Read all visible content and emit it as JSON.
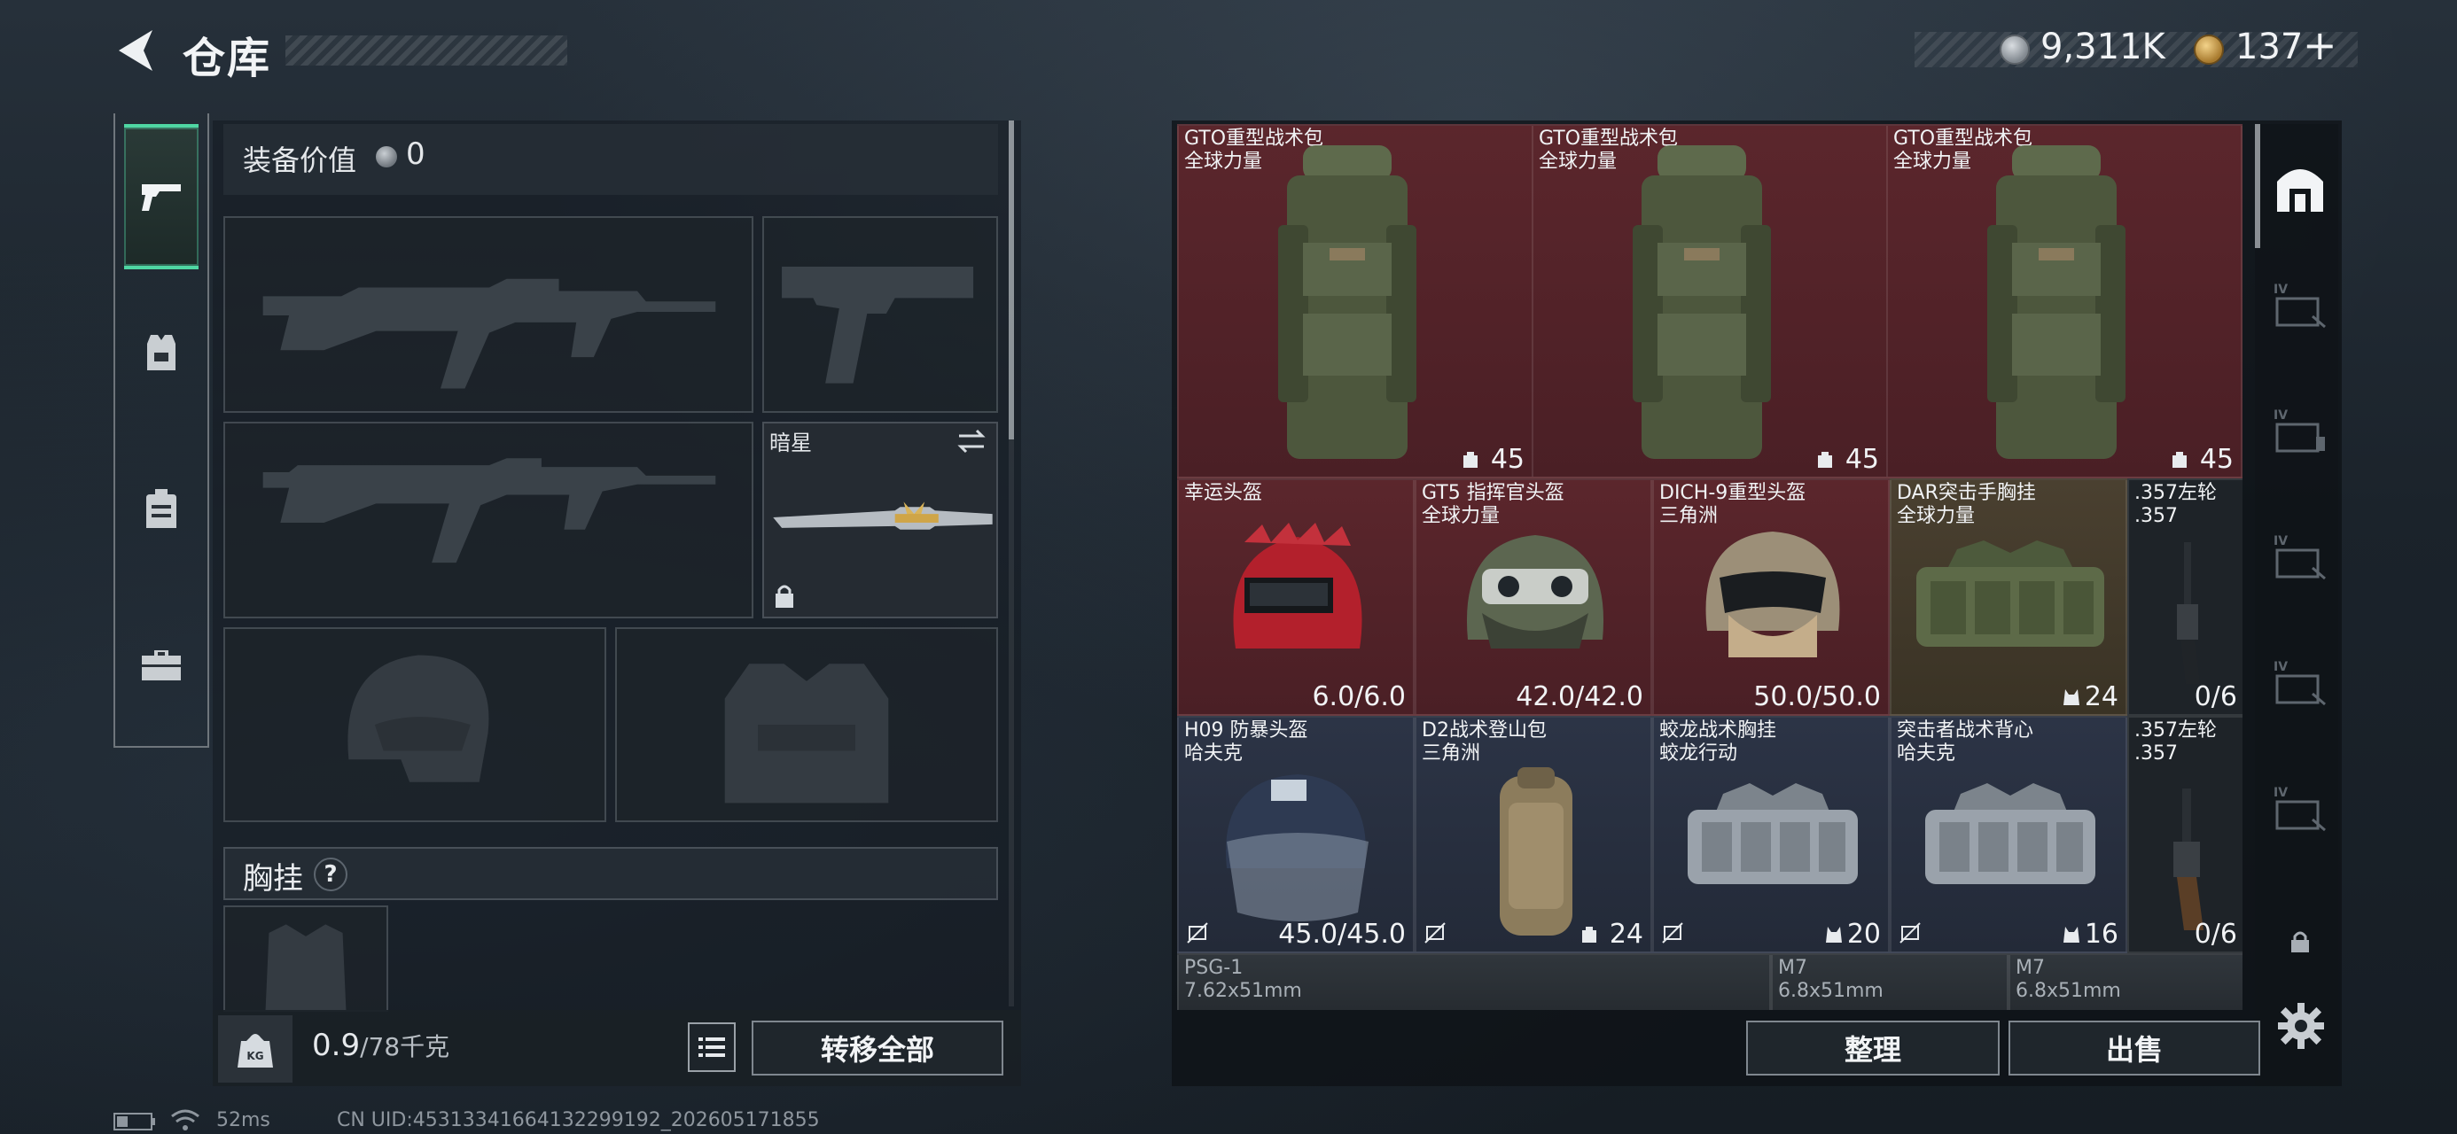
{
  "header": {
    "title": "仓库",
    "silver": "9,311K",
    "gold": "137",
    "plus": "+"
  },
  "rail": {
    "tabs": [
      {
        "name": "weapons",
        "icon": "pistol-icon",
        "active": true
      },
      {
        "name": "armor",
        "icon": "vest-icon",
        "active": false
      },
      {
        "name": "backpack",
        "icon": "backpack-icon",
        "active": false
      },
      {
        "name": "kit",
        "icon": "toolbox-icon",
        "active": false
      }
    ]
  },
  "loadout": {
    "value_label": "装备价值",
    "value": "0",
    "melee_name": "暗星",
    "chest_label": "胸挂",
    "help": "?"
  },
  "weight": {
    "current": "0.9",
    "max": "/78千克"
  },
  "buttons": {
    "transfer_all": "转移全部",
    "sort": "整理",
    "sell": "出售"
  },
  "warehouse": {
    "row1": [
      {
        "name": "GTO重型战术包",
        "sub": "全球力量",
        "value": "45",
        "rarity": "red"
      },
      {
        "name": "GTO重型战术包",
        "sub": "全球力量",
        "value": "45",
        "rarity": "red"
      },
      {
        "name": "GTO重型战术包",
        "sub": "全球力量",
        "value": "45",
        "rarity": "red"
      }
    ],
    "row2": [
      {
        "name": "幸运头盔",
        "sub": "",
        "value": "6.0/6.0",
        "rarity": "red"
      },
      {
        "name": "GT5 指挥官头盔",
        "sub": "全球力量",
        "value": "42.0/42.0",
        "rarity": "red"
      },
      {
        "name": "DICH-9重型头盔",
        "sub": "三角洲",
        "value": "50.0/50.0",
        "rarity": "red"
      },
      {
        "name": "DAR突击手胸挂",
        "sub": "全球力量",
        "value": "24",
        "rarity": "gold"
      },
      {
        "name": ".357左轮",
        "sub": ".357",
        "value": "0/6",
        "rarity": "dark"
      }
    ],
    "row3": [
      {
        "name": "H09 防暴头盔",
        "sub": "哈夫克",
        "value": "45.0/45.0",
        "rarity": "blue"
      },
      {
        "name": "D2战术登山包",
        "sub": "三角洲",
        "value": "24",
        "rarity": "blue"
      },
      {
        "name": "蛟龙战术胸挂",
        "sub": "蛟龙行动",
        "value": "20",
        "rarity": "blue"
      },
      {
        "name": "突击者战术背心",
        "sub": "哈夫克",
        "value": "16",
        "rarity": "blue"
      },
      {
        "name": ".357左轮",
        "sub": ".357",
        "value": "0/6",
        "rarity": "dark"
      }
    ],
    "row4": [
      {
        "name": "PSG-1",
        "sub": "7.62x51mm"
      },
      {
        "name": "M7",
        "sub": "6.8x51mm"
      },
      {
        "name": "M7",
        "sub": "6.8x51mm"
      }
    ]
  },
  "status": {
    "ping": "52ms",
    "uid": "CN UID:453133416641322991​92_202605171855"
  },
  "colors": {
    "accent": "#4fd6a3",
    "rarity_red": "#5b262c",
    "rarity_gold": "#4a4030",
    "rarity_blue": "#2c3446"
  }
}
